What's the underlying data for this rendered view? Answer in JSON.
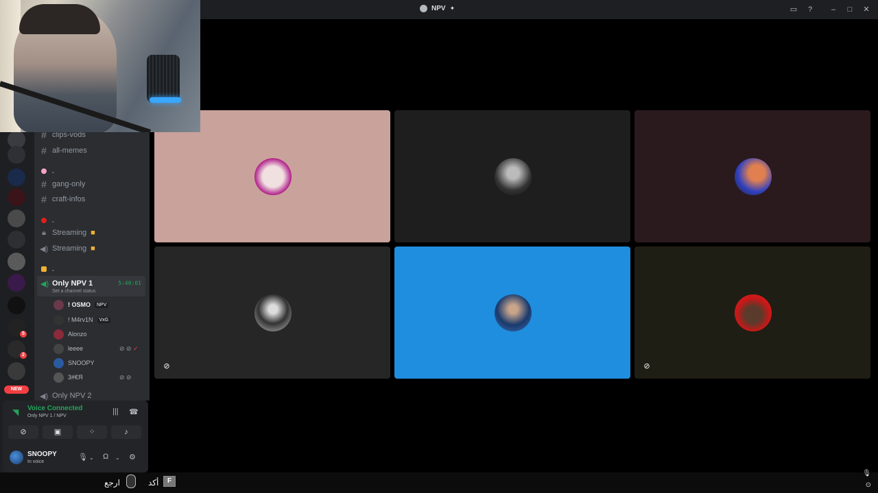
{
  "window": {
    "title": "NPV",
    "title_icon": "server-icon",
    "controls": [
      "inbox-icon",
      "help-icon",
      "minimize-icon",
      "maximize-icon",
      "close-icon"
    ]
  },
  "channels": {
    "text": [
      {
        "name": "clips-vods"
      },
      {
        "name": "all-memes"
      },
      {
        "name": "gang-only"
      },
      {
        "name": "craft-infos"
      }
    ],
    "voice_locked": [
      {
        "name": "Streaming"
      },
      {
        "name": "Streaming"
      }
    ],
    "active_voice": {
      "name": "Only NPV 1",
      "timer": "5:40:01",
      "status": "Set a channel status"
    },
    "members": [
      {
        "name": "! OSMO",
        "tag": "NPV"
      },
      {
        "name": "! M4rv1N",
        "tag": "VxG"
      },
      {
        "name": "Alonzo",
        "tag": ""
      },
      {
        "name": "leeee",
        "tag": ""
      },
      {
        "name": "SNOOPY",
        "tag": ""
      },
      {
        "name": "3#€Я",
        "tag": ""
      }
    ],
    "next_voice": "Only NPV 2"
  },
  "rail": {
    "new_label": "NEW",
    "badges": [
      "5",
      "2"
    ]
  },
  "voice_panel": {
    "title": "Voice Connected",
    "subtitle": "Only NPV 1 / NPV"
  },
  "user_panel": {
    "name": "SNOOPY",
    "status": "In voice"
  },
  "tiles": [
    {
      "bg": "#c9a29b",
      "muted": false
    },
    {
      "bg": "#1e1e1e",
      "muted": false
    },
    {
      "bg": "#2a1a1e",
      "muted": false
    },
    {
      "bg": "#262626",
      "muted": true
    },
    {
      "bg": "#1f8ede",
      "muted": false
    },
    {
      "bg": "#1f1e14",
      "muted": true
    }
  ],
  "taskbar": {
    "label_1": "ارجع",
    "label_2": "أكد",
    "key": "F"
  },
  "colors": {
    "accent_green": "#23a55a",
    "speaking_blue": "#1f8ede",
    "danger_red": "#f23f43"
  }
}
